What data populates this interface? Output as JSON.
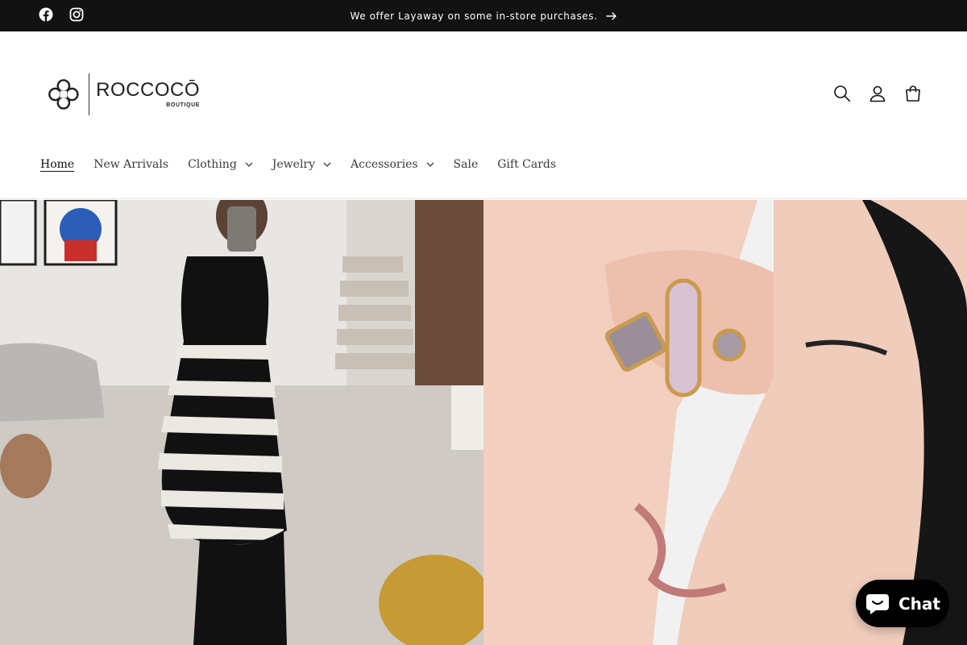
{
  "announcement": {
    "message": "We offer Layaway on some in-store purchases.",
    "social_icons": [
      "facebook-icon",
      "instagram-icon"
    ]
  },
  "brand": {
    "name": "ROCCOCŌ",
    "tagline": "BOUTIQUE"
  },
  "header_icons": [
    "search-icon",
    "account-icon",
    "cart-icon"
  ],
  "nav": {
    "items": [
      {
        "label": "Home",
        "active": true,
        "dropdown": false
      },
      {
        "label": "New Arrivals",
        "active": false,
        "dropdown": false
      },
      {
        "label": "Clothing",
        "active": false,
        "dropdown": true
      },
      {
        "label": "Jewelry",
        "active": false,
        "dropdown": true
      },
      {
        "label": "Accessories",
        "active": false,
        "dropdown": true
      },
      {
        "label": "Sale",
        "active": false,
        "dropdown": false
      },
      {
        "label": "Gift Cards",
        "active": false,
        "dropdown": false
      }
    ]
  },
  "hero": {
    "left_image": "striped-dress-mirror-selfie",
    "right_image": "ring-on-hand-near-face"
  },
  "chat": {
    "label": "Chat"
  },
  "colors": {
    "announcement_bg": "#121212",
    "text": "#121212",
    "chat_bg": "#000000"
  }
}
